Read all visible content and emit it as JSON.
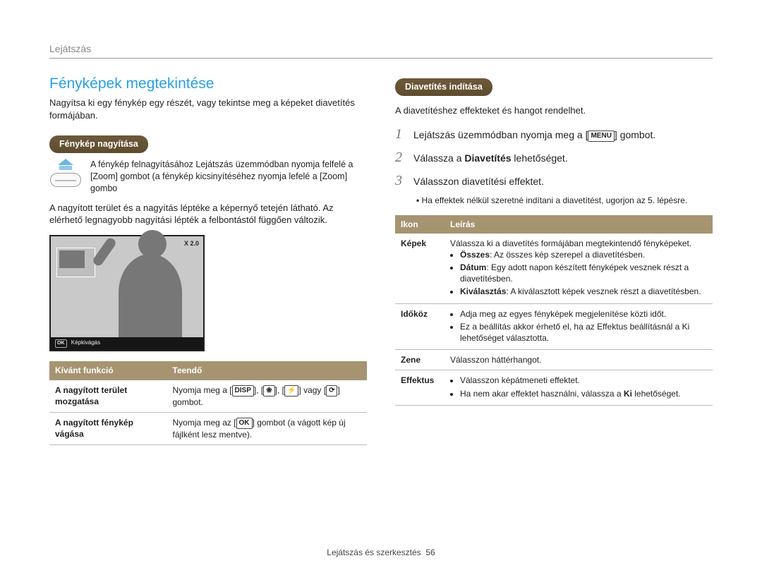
{
  "header": {
    "breadcrumb": "Lejátszás"
  },
  "left": {
    "title": "Fényképek megtekintése",
    "intro": "Nagyítsa ki egy fénykép egy részét, vagy tekintse meg a képeket diavetítés formájában.",
    "section1_label": "Fénykép nagyítása",
    "zoom_text": "A fénykép felnagyításához Lejátszás üzemmódban nyomja felfelé a [Zoom] gombot (a fénykép kicsinyítéséhez nyomja lefelé a [Zoom] gombo",
    "para2": "A nagyított terület és a nagyítás léptéke a képernyő tetején látható. Az elérhető legnagyobb nagyítási lépték a felbontástól függően változik.",
    "screen": {
      "zoom": "X 2.0",
      "ok": "OK",
      "crop": "Képkivágás"
    },
    "table": {
      "head1": "Kívánt funkció",
      "head2": "Teendő",
      "rows": [
        {
          "fn": "A nagyított terület mozgatása",
          "do_pre": "Nyomja meg a [",
          "k1": "DISP",
          "sep1": "], [",
          "k2": "❀",
          "sep2": "], [",
          "k3": "⚡",
          "sep3": "] vagy [",
          "k4": "⟳",
          "do_post": "] gombot."
        },
        {
          "fn": "A nagyított fénykép vágása",
          "do_pre": "Nyomja meg az [",
          "k1": "OK",
          "do_post": "] gombot (a vágott kép új fájlként lesz mentve)."
        }
      ]
    }
  },
  "right": {
    "section_label": "Diavetítés indítása",
    "intro": "A diavetítéshez effekteket és hangot rendelhet.",
    "steps": [
      {
        "pre": "Lejátszás üzemmódban nyomja meg a [",
        "key": "MENU",
        "post": "] gombot."
      },
      {
        "pre": "Válassza a ",
        "bold": "Diavetítés",
        "post": " lehetőséget."
      },
      {
        "pre": "Válasszon diavetítési effektet.",
        "key": "",
        "post": ""
      }
    ],
    "step3_sub": "Ha effektek nélkül szeretné indítani a diavetítést, ugorjon az 5. lépésre.",
    "table": {
      "head1": "Ikon",
      "head2": "Leírás",
      "rows": [
        {
          "ic": "Képek",
          "lead": "Válassza ki a diavetítés formájában megtekintendő fényképeket.",
          "items": [
            {
              "b": "Összes",
              "t": ": Az összes kép szerepel a diavetítésben."
            },
            {
              "b": "Dátum",
              "t": ": Egy adott napon készített fényképek vesznek részt a diavetítésben."
            },
            {
              "b": "Kiválasztás",
              "t": ": A kiválasztott képek vesznek részt a diavetítésben."
            }
          ]
        },
        {
          "ic": "Időköz",
          "items": [
            {
              "b": "",
              "t": "Adja meg az egyes fényképek megjelenítése közti időt."
            },
            {
              "b": "",
              "t": "Ez a beállítás akkor érhető el, ha az Effektus beállításnál a Ki lehetőséget választotta."
            }
          ]
        },
        {
          "ic": "Zene",
          "plain": "Válasszon háttérhangot."
        },
        {
          "ic": "Effektus",
          "items": [
            {
              "b": "",
              "t": "Válasszon képátmeneti effektet."
            },
            {
              "b": "",
              "t_pre": "Ha nem akar effektet használni, válassza a ",
              "b2": "Ki",
              "t_post": " lehetőséget."
            }
          ]
        }
      ]
    }
  },
  "footer": {
    "section": "Lejátszás és szerkesztés",
    "page": "56"
  }
}
